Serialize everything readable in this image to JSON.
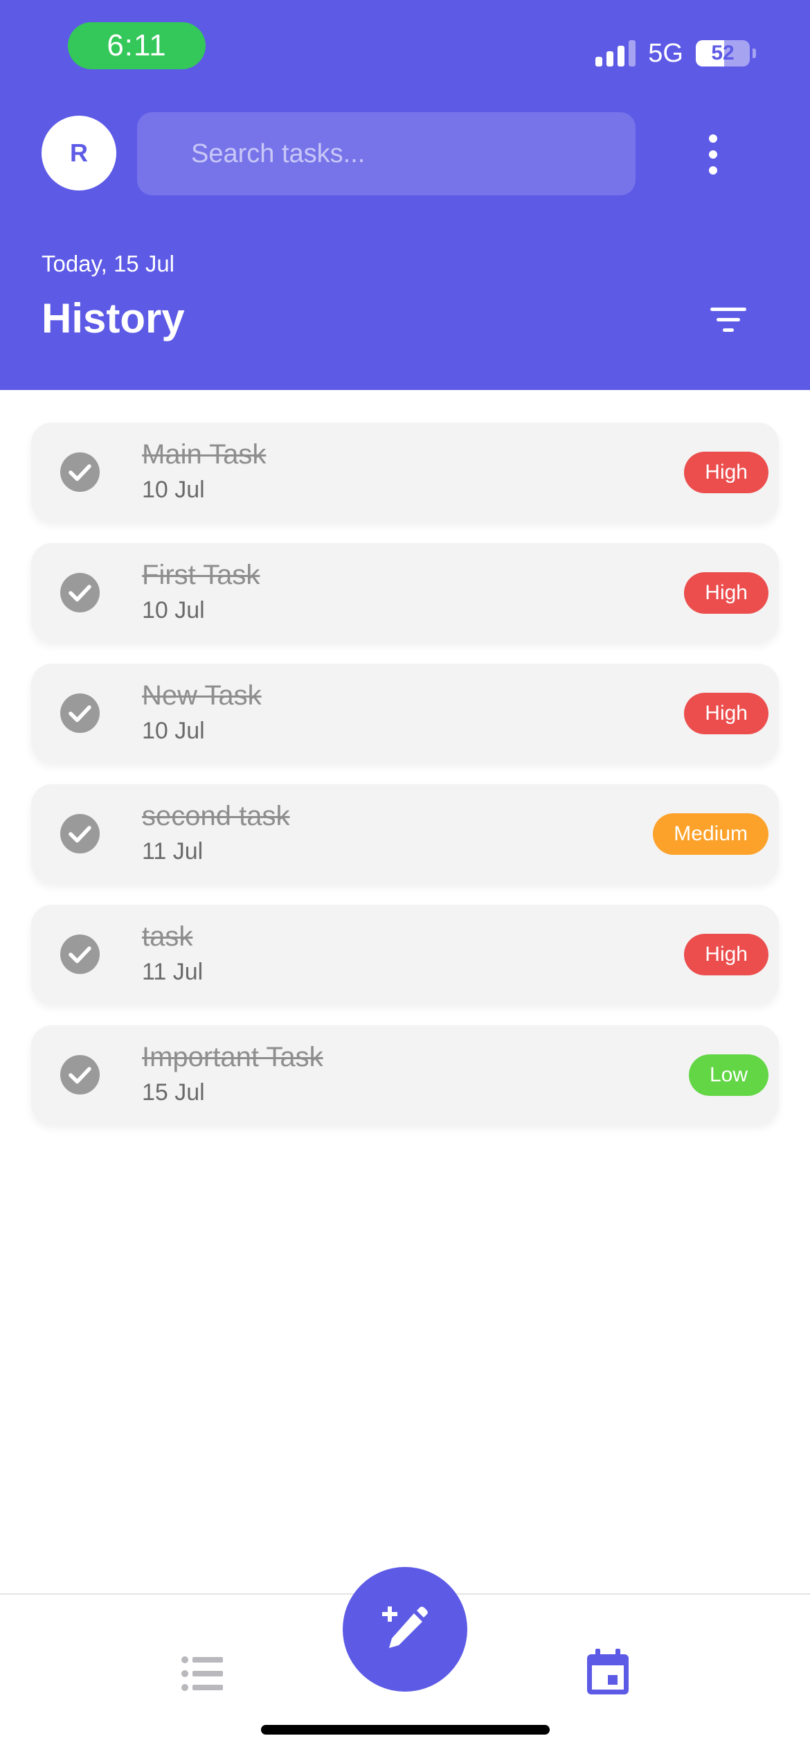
{
  "status_bar": {
    "time": "6:11",
    "network": "5G",
    "battery": "52",
    "time_pill_color": "#34c759"
  },
  "header": {
    "avatar_initial": "R",
    "search_placeholder": "Search tasks...",
    "date_label": "Today, 15 Jul",
    "title": "History",
    "background_color": "#5d5ae6"
  },
  "icons": {
    "more": "more-vertical-icon",
    "filter": "filter-icon",
    "completed": "check-circle-icon",
    "add": "edit-add-icon",
    "list_tab": "list-icon",
    "calendar_tab": "calendar-icon"
  },
  "priority_colors": {
    "High": "#ec4e4e",
    "Medium": "#fca22a",
    "Low": "#62d644"
  },
  "tasks": [
    {
      "title": "Main Task",
      "date": "10 Jul",
      "priority": "High"
    },
    {
      "title": "First Task",
      "date": "10 Jul",
      "priority": "High"
    },
    {
      "title": "New Task",
      "date": "10 Jul",
      "priority": "High"
    },
    {
      "title": "second task",
      "date": "11 Jul",
      "priority": "Medium"
    },
    {
      "title": "task",
      "date": "11 Jul",
      "priority": "High"
    },
    {
      "title": "Important Task",
      "date": "15 Jul",
      "priority": "Low"
    }
  ],
  "bottom_nav": {
    "active_tab": "calendar",
    "active_color": "#5d5ae6",
    "inactive_color": "#b8b8bd"
  }
}
